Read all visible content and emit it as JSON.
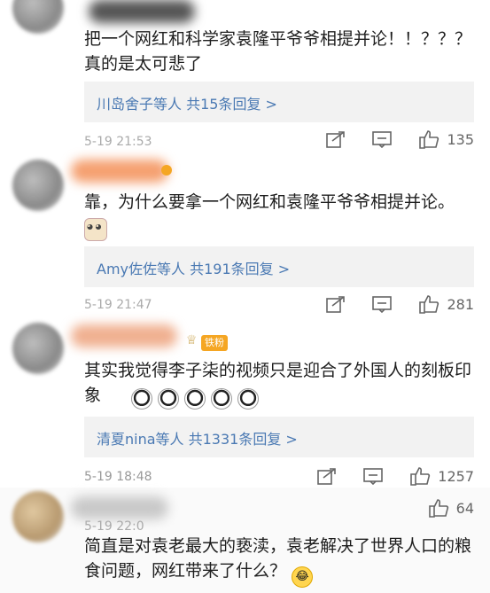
{
  "comments": [
    {
      "text": "把一个网红和科学家袁隆平爷爷相提并论！！？？？真的是太可悲了",
      "reply": "川岛舍子等人 共15条回复 >",
      "time": "5-19 21:53",
      "likes": "135"
    },
    {
      "text": "靠，为什么要拿一个网红和袁隆平爷爷相提并论。",
      "reply": "Amy佐佐等人 共191条回复 >",
      "time": "5-19 21:47",
      "likes": "281"
    },
    {
      "text": "其实我觉得李子柒的视频只是迎合了外国人的刻板印象",
      "badge": "铁粉",
      "reply": "清夏nina等人 共1331条回复 >",
      "time": "5-19 18:48",
      "likes": "1257"
    },
    {
      "text": "简直是对袁老最大的亵渎，袁老解决了世界人口的粮食问题，网红带来了什么？",
      "time": "5-19 22:0",
      "likes": "64"
    }
  ],
  "icons": [
    "share-icon",
    "comment-icon",
    "like-icon"
  ]
}
